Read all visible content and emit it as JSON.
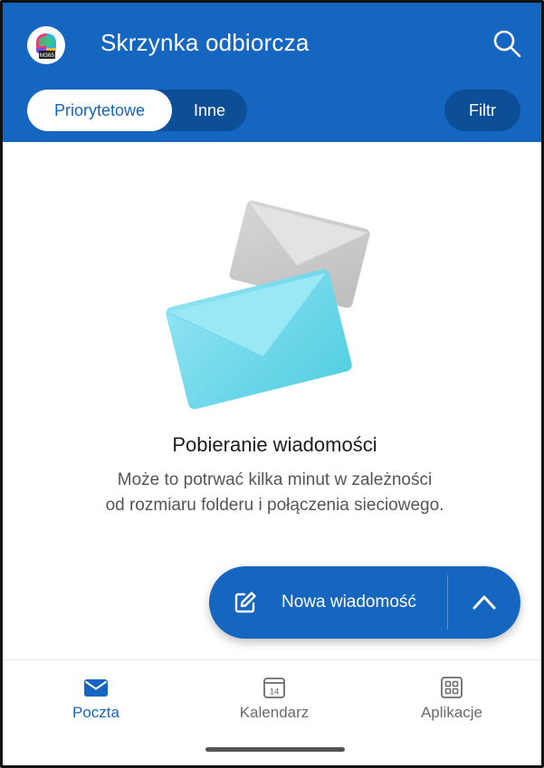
{
  "header": {
    "title": "Skrzynka odbiorcza",
    "avatar_badge": "M365",
    "accent": "#1466c0",
    "search_icon": "search-icon"
  },
  "tabs": {
    "items": [
      {
        "label": "Priorytetowe",
        "selected": true
      },
      {
        "label": "Inne",
        "selected": false
      }
    ]
  },
  "filter": {
    "label": "Filtr"
  },
  "empty_state": {
    "title": "Pobieranie wiadomości",
    "description_line1": "Może to potrwać kilka minut w zależności",
    "description_line2": "od rozmiaru folderu i połączenia sieciowego.",
    "illustration": "envelopes-icon"
  },
  "fab": {
    "label": "Nowa wiadomość",
    "icon": "compose-icon",
    "expand_icon": "chevron-up-icon"
  },
  "bottom_nav": {
    "items": [
      {
        "label": "Poczta",
        "icon": "mail-icon",
        "active": true
      },
      {
        "label": "Kalendarz",
        "icon": "calendar-icon",
        "badge": "14",
        "active": false
      },
      {
        "label": "Aplikacje",
        "icon": "apps-icon",
        "active": false
      }
    ]
  }
}
